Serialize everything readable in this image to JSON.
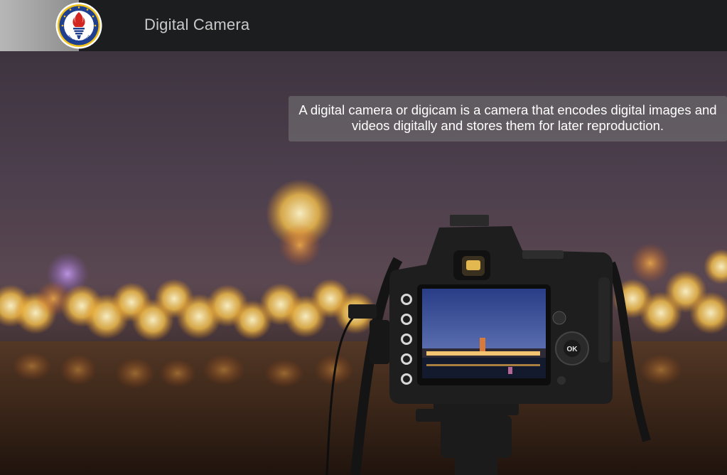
{
  "header": {
    "title": "Digital Camera",
    "logo_icon": "university-torch-logo-icon",
    "logo_text": "TED ÜNİVERSİTESİ"
  },
  "hero": {
    "caption": "A digital camera or digicam is a camera that encodes digital images and videos digitally and stores them for later reproduction.",
    "camera_button_label": "OK"
  },
  "colors": {
    "header_bg": "#1c1d1e",
    "title_text": "#c9c9c9",
    "caption_bg": "rgba(120,120,120,0.55)",
    "logo_blue": "#1f3f8f",
    "logo_gold": "#f2c21b",
    "logo_red": "#d3261f"
  }
}
